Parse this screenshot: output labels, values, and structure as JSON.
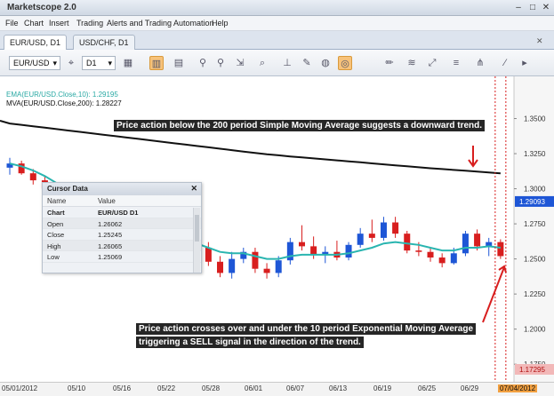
{
  "window": {
    "title": "Marketscope 2.0",
    "controls": [
      "–",
      "□",
      "✕"
    ]
  },
  "menu": [
    "File",
    "Chart",
    "Insert",
    "Trading",
    "Alerts and Trading Automation",
    "Help"
  ],
  "tabs": [
    {
      "label": "EUR/USD, D1",
      "active": true
    },
    {
      "label": "USD/CHF, D1",
      "active": false
    }
  ],
  "toolbar": {
    "symbol": "EUR/USD",
    "timeframe": "D1"
  },
  "indicators": {
    "ema_label": "EMA(EUR/USD.Close,10): 1.29195",
    "mva_label": "MVA(EUR/USD.Close,200): 1.28227"
  },
  "annotations": {
    "top": "Price action below the 200 period Simple Moving Average suggests a downward trend.",
    "bottom_line1": "Price action crosses over and under the 10 period Exponential Moving Average",
    "bottom_line2": "triggering a SELL signal in the direction of the trend."
  },
  "cursor_data": {
    "title": "Cursor Data",
    "col_name": "Name",
    "col_value": "Value",
    "rows": [
      {
        "name": "Chart",
        "value": "EUR/USD D1"
      },
      {
        "name": "Open",
        "value": "1.26062"
      },
      {
        "name": "Close",
        "value": "1.25245"
      },
      {
        "name": "High",
        "value": "1.26065"
      },
      {
        "name": "Low",
        "value": "1.25069"
      }
    ]
  },
  "colors": {
    "up": "#1e56d6",
    "down": "#d81e1e",
    "ema": "#2ab5b0",
    "mva": "#111111",
    "annotation_arrow": "#d81e1e",
    "current_price_bg": "#1e56d6"
  },
  "chart_data": {
    "type": "candlestick",
    "price_labels": [
      "1.3500",
      "1.3250",
      "1.3000",
      "1.2750",
      "1.2500",
      "1.2250",
      "1.2000",
      "1.1750"
    ],
    "current_price_label": "1.29093",
    "bottom_price_label": "1.17295",
    "date_labels": [
      "05/01/2012",
      "05/10",
      "05/16",
      "05/22",
      "05/28",
      "06/01",
      "06/07",
      "06/13",
      "06/19",
      "06/25",
      "06/29",
      "07/04/2012"
    ],
    "ylim": [
      1.165,
      1.375
    ],
    "candles": [
      [
        1.315,
        1.322,
        1.31,
        1.318
      ],
      [
        1.318,
        1.32,
        1.31,
        1.311
      ],
      [
        1.311,
        1.314,
        1.303,
        1.306
      ],
      [
        1.306,
        1.309,
        1.299,
        1.3
      ],
      [
        1.3,
        1.304,
        1.292,
        1.295
      ],
      [
        1.295,
        1.298,
        1.283,
        1.287
      ],
      [
        1.287,
        1.29,
        1.276,
        1.28
      ],
      [
        1.28,
        1.285,
        1.275,
        1.282
      ],
      [
        1.282,
        1.285,
        1.271,
        1.274
      ],
      [
        1.274,
        1.278,
        1.266,
        1.269
      ],
      [
        1.269,
        1.275,
        1.262,
        1.27
      ],
      [
        1.27,
        1.272,
        1.259,
        1.262
      ],
      [
        1.262,
        1.266,
        1.255,
        1.258
      ],
      [
        1.258,
        1.262,
        1.25,
        1.253
      ],
      [
        1.253,
        1.26,
        1.248,
        1.256
      ],
      [
        1.256,
        1.266,
        1.252,
        1.262
      ],
      [
        1.262,
        1.268,
        1.255,
        1.258
      ],
      [
        1.258,
        1.262,
        1.245,
        1.248
      ],
      [
        1.248,
        1.252,
        1.237,
        1.24
      ],
      [
        1.24,
        1.255,
        1.236,
        1.25
      ],
      [
        1.25,
        1.258,
        1.247,
        1.255
      ],
      [
        1.255,
        1.258,
        1.24,
        1.243
      ],
      [
        1.243,
        1.247,
        1.236,
        1.24
      ],
      [
        1.24,
        1.252,
        1.237,
        1.249
      ],
      [
        1.249,
        1.265,
        1.246,
        1.262
      ],
      [
        1.262,
        1.274,
        1.256,
        1.259
      ],
      [
        1.259,
        1.266,
        1.25,
        1.253
      ],
      [
        1.253,
        1.259,
        1.247,
        1.255
      ],
      [
        1.255,
        1.263,
        1.249,
        1.251
      ],
      [
        1.251,
        1.262,
        1.249,
        1.26
      ],
      [
        1.26,
        1.272,
        1.258,
        1.268
      ],
      [
        1.268,
        1.278,
        1.262,
        1.265
      ],
      [
        1.265,
        1.28,
        1.263,
        1.276
      ],
      [
        1.276,
        1.28,
        1.265,
        1.268
      ],
      [
        1.268,
        1.27,
        1.254,
        1.256
      ],
      [
        1.256,
        1.262,
        1.252,
        1.255
      ],
      [
        1.255,
        1.258,
        1.248,
        1.251
      ],
      [
        1.251,
        1.254,
        1.244,
        1.247
      ],
      [
        1.247,
        1.258,
        1.246,
        1.254
      ],
      [
        1.254,
        1.27,
        1.252,
        1.268
      ],
      [
        1.268,
        1.271,
        1.256,
        1.259
      ],
      [
        1.259,
        1.265,
        1.252,
        1.262
      ],
      [
        1.262,
        1.264,
        1.25,
        1.252
      ]
    ],
    "ema": [
      1.318,
      1.316,
      1.313,
      1.309,
      1.304,
      1.299,
      1.294,
      1.29,
      1.285,
      1.28,
      1.277,
      1.273,
      1.269,
      1.265,
      1.262,
      1.262,
      1.261,
      1.258,
      1.255,
      1.254,
      1.254,
      1.252,
      1.25,
      1.25,
      1.252,
      1.253,
      1.253,
      1.253,
      1.253,
      1.254,
      1.256,
      1.258,
      1.261,
      1.262,
      1.261,
      1.26,
      1.258,
      1.256,
      1.256,
      1.258,
      1.258,
      1.259,
      1.258
    ],
    "mva": [
      1.3465,
      1.3455,
      1.3445,
      1.3435,
      1.3425,
      1.3415,
      1.3405,
      1.3395,
      1.3385,
      1.3375,
      1.3365,
      1.3355,
      1.3345,
      1.3335,
      1.3325,
      1.3315,
      1.3305,
      1.3295,
      1.3285,
      1.3275,
      1.3265,
      1.3255,
      1.3245,
      1.3238,
      1.323,
      1.3223,
      1.3216,
      1.3209,
      1.3202,
      1.3195,
      1.3188,
      1.3181,
      1.3174,
      1.3167,
      1.316,
      1.3153,
      1.3146,
      1.314,
      1.3134,
      1.3128,
      1.3122,
      1.3116,
      1.311
    ]
  }
}
